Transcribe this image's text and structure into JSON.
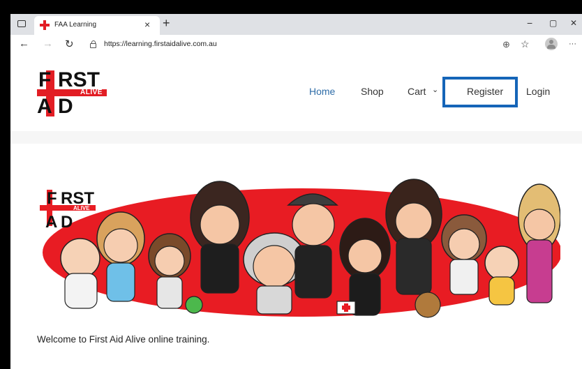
{
  "browser": {
    "tab_title": "FAA Learning",
    "tab_close": "×",
    "new_tab": "+",
    "url": "https://learning.firstaidalive.com.au",
    "back": "←",
    "forward": "→",
    "reload": "↻",
    "zoom_icon": "⊕",
    "favorites_icon": "☆",
    "menu": "···",
    "minimize": "−",
    "maximize": "▢",
    "close": "✕"
  },
  "logo": {
    "line1_a": "F",
    "line1_b": "RST",
    "line2_a": "A",
    "line2_b": "D",
    "badge": "ALIVE"
  },
  "nav": {
    "items": [
      {
        "label": "Home",
        "active": true
      },
      {
        "label": "Shop"
      },
      {
        "label": "Cart"
      },
      {
        "label": "Register",
        "highlighted": true
      },
      {
        "label": "Login"
      }
    ],
    "cart_chevron": "⌄"
  },
  "banner": {
    "badge_line1_a": "F",
    "badge_line1_b": "RST",
    "badge_line2_a": "A",
    "badge_line2_b": "D",
    "badge_alive": "ALIVE",
    "colors": {
      "oval": "#e81c23",
      "skin": "#f3c7a8"
    }
  },
  "main": {
    "welcome": "Welcome to First Aid Alive online training."
  }
}
